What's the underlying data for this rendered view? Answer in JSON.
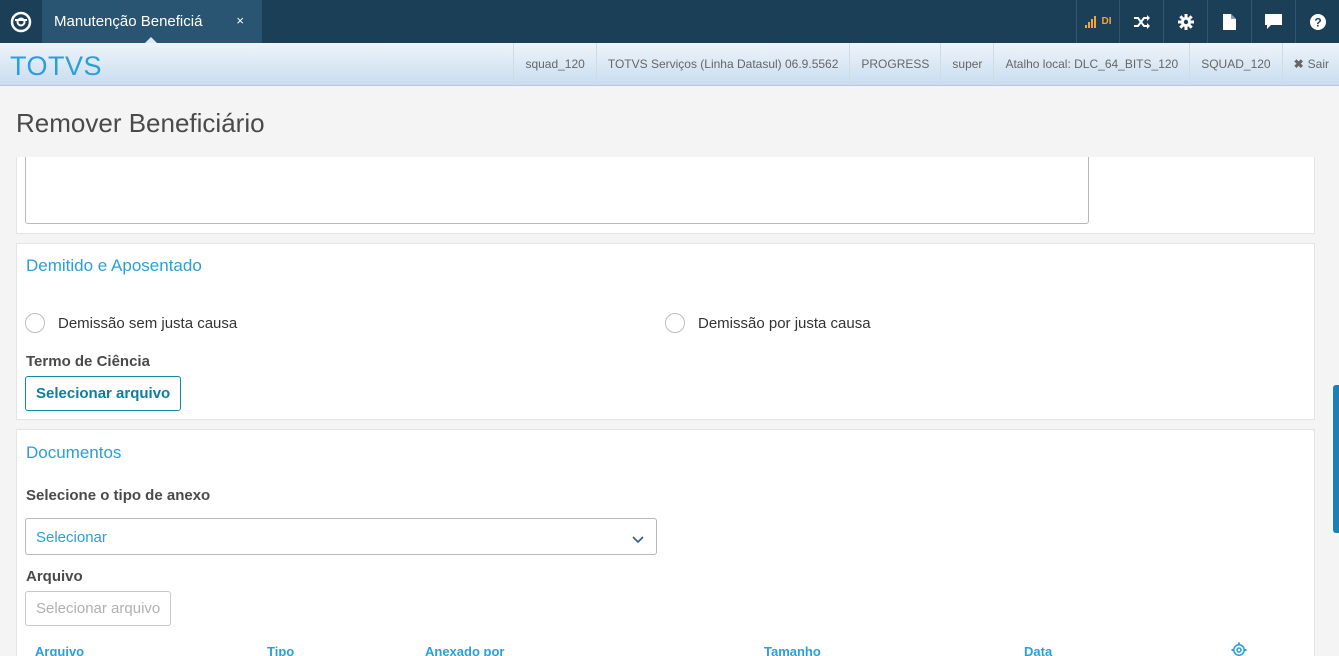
{
  "topbar": {
    "tab_title": "Manutenção Beneficiá",
    "tab_close": "×",
    "signal_label": "DI",
    "icons": [
      "totvs-logo-icon",
      "signal-icon",
      "shuffle-icon",
      "gear-icon",
      "document-icon",
      "chat-icon",
      "help-icon"
    ]
  },
  "subbar": {
    "brand": "TOTVS",
    "infos": [
      "squad_120",
      "TOTVS Serviços (Linha Datasul) 06.9.5562",
      "PROGRESS",
      "super",
      "Atalho local: DLC_64_BITS_120",
      "SQUAD_120"
    ],
    "exit_label": "Sair"
  },
  "page": {
    "title": "Remover Beneficiário"
  },
  "dismissal": {
    "title": "Demitido e Aposentado",
    "option1": "Demissão sem justa causa",
    "option2": "Demissão por justa causa",
    "term_label": "Termo de Ciência",
    "select_file_button": "Selecionar arquivo"
  },
  "documents": {
    "title": "Documentos",
    "attachment_type_label": "Selecione o tipo de anexo",
    "select_value": "Selecionar",
    "file_label": "Arquivo",
    "select_file_button": "Selecionar arquivo",
    "columns": [
      "Arquivo",
      "Tipo",
      "Anexado por",
      "Tamanho",
      "Data"
    ]
  },
  "colors": {
    "topbar": "#1c3f58",
    "accent": "#2a9fd8",
    "button_border": "#0d8aaa",
    "signal": "#f0a53a"
  }
}
